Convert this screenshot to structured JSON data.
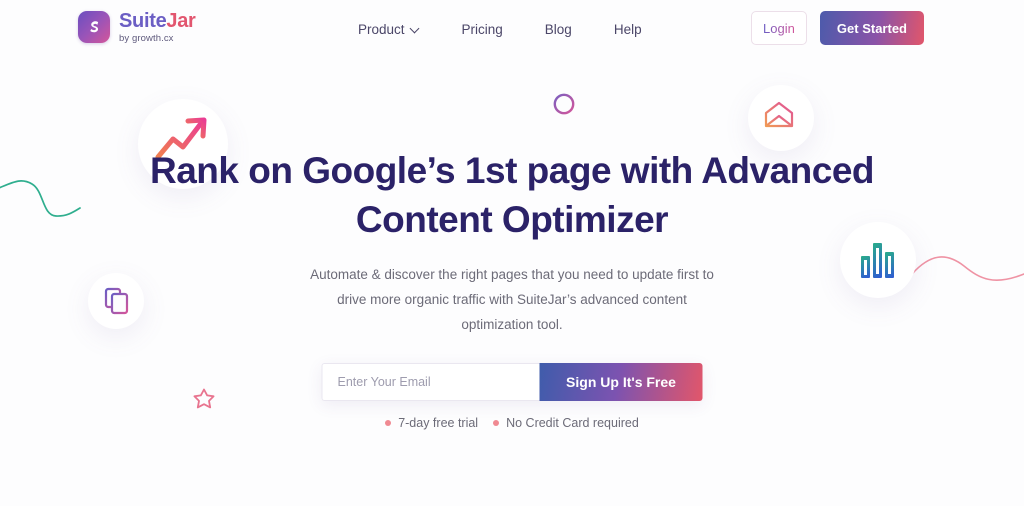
{
  "brand": {
    "name_part1": "Suite",
    "name_part2": "Jar",
    "tagline": "by growth.cx",
    "logo_letter": "S",
    "gradient_start": "#6a4ec0",
    "gradient_end": "#d4569a"
  },
  "nav": {
    "items": [
      {
        "label": "Product",
        "has_dropdown": true
      },
      {
        "label": "Pricing",
        "has_dropdown": false
      },
      {
        "label": "Blog",
        "has_dropdown": false
      },
      {
        "label": "Help",
        "has_dropdown": false
      }
    ]
  },
  "actions": {
    "login_label": "Login",
    "get_started_label": "Get Started"
  },
  "hero": {
    "headline_line1": "Rank on Google’s 1st page with Advanced",
    "headline_line2": "Content Optimizer",
    "headline_color": "#2b2268",
    "subtitle_line1": "Automate & discover the right pages that you need to update first to",
    "subtitle_line2": "drive more organic traffic with SuiteJar’s advanced content",
    "subtitle_line3": "optimization tool."
  },
  "signup_form": {
    "email_placeholder": "Enter Your Email",
    "email_value": "",
    "submit_label": "Sign Up It's Free"
  },
  "trial_notes": [
    {
      "label": "7-day free trial",
      "dot_color": "#f08a92"
    },
    {
      "label": "No Credit Card required",
      "dot_color": "#f08a92"
    }
  ],
  "decorations": [
    {
      "icon": "trending-up-icon",
      "color_start": "#f0804f",
      "color_end": "#ea3d93"
    },
    {
      "icon": "circle-outline-icon",
      "color_start": "#7b5fc0",
      "color_end": "#d4569a"
    },
    {
      "icon": "envelope-icon",
      "color_start": "#f09a55",
      "color_end": "#e0509a"
    },
    {
      "icon": "bar-chart-icon",
      "color_start": "#2aa88e",
      "color_end": "#2f5fd0"
    },
    {
      "icon": "copy-icon",
      "color_start": "#6b5ec4",
      "color_end": "#d4569a"
    },
    {
      "icon": "star-outline-icon",
      "color_start": "#e8748f",
      "color_end": "#e8748f"
    },
    {
      "icon": "wave-line-left-icon",
      "color_start": "#2fae8e",
      "color_end": "#2fae8e"
    },
    {
      "icon": "wave-line-right-icon",
      "color_start": "#ef93a4",
      "color_end": "#ef93a4"
    }
  ]
}
